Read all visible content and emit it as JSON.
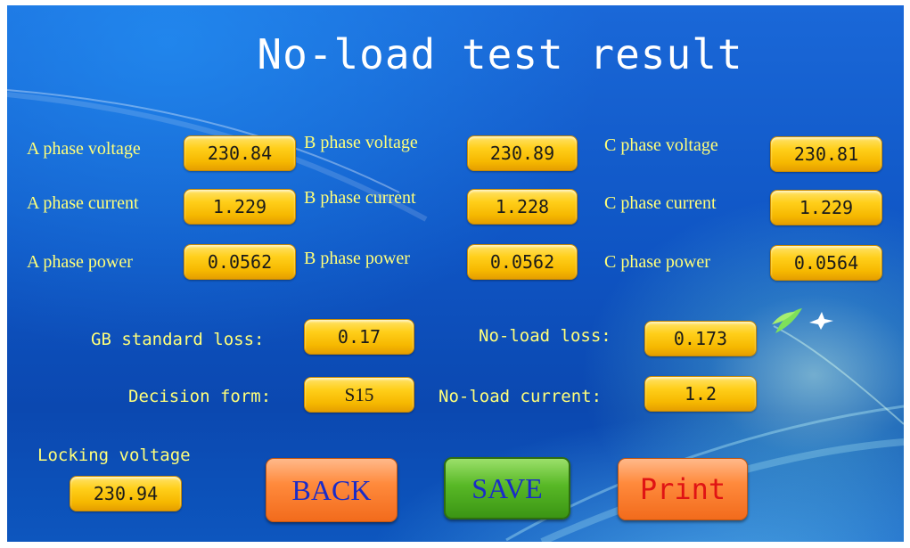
{
  "title": "No-load test result",
  "phases": {
    "a_voltage_label": "A phase voltage",
    "a_voltage": "230.84",
    "b_voltage_label": "B phase voltage",
    "b_voltage": "230.89",
    "c_voltage_label": "C phase voltage",
    "c_voltage": "230.81",
    "a_current_label": "A phase current",
    "a_current": "1.229",
    "b_current_label": "B phase current",
    "b_current": "1.228",
    "c_current_label": "C phase current",
    "c_current": "1.229",
    "a_power_label": "A phase power",
    "a_power": "0.0562",
    "b_power_label": "B phase power",
    "b_power": "0.0562",
    "c_power_label": "C phase power",
    "c_power": "0.0564"
  },
  "summary": {
    "gb_loss_label": "GB standard loss:",
    "gb_loss": "0.17",
    "noload_loss_label": "No-load loss:",
    "noload_loss": "0.173",
    "decision_label": "Decision form:",
    "decision": "S15",
    "noload_current_label": "No-load current:",
    "noload_current": "1.2"
  },
  "locking": {
    "label": "Locking voltage",
    "value": "230.94"
  },
  "buttons": {
    "back": "BACK",
    "save": "SAVE",
    "print": "Print"
  },
  "colors": {
    "label": "#ffff7a",
    "value_box": "#ffcf1a",
    "back_text": "#1a2cc8",
    "print_text": "#e01414"
  }
}
